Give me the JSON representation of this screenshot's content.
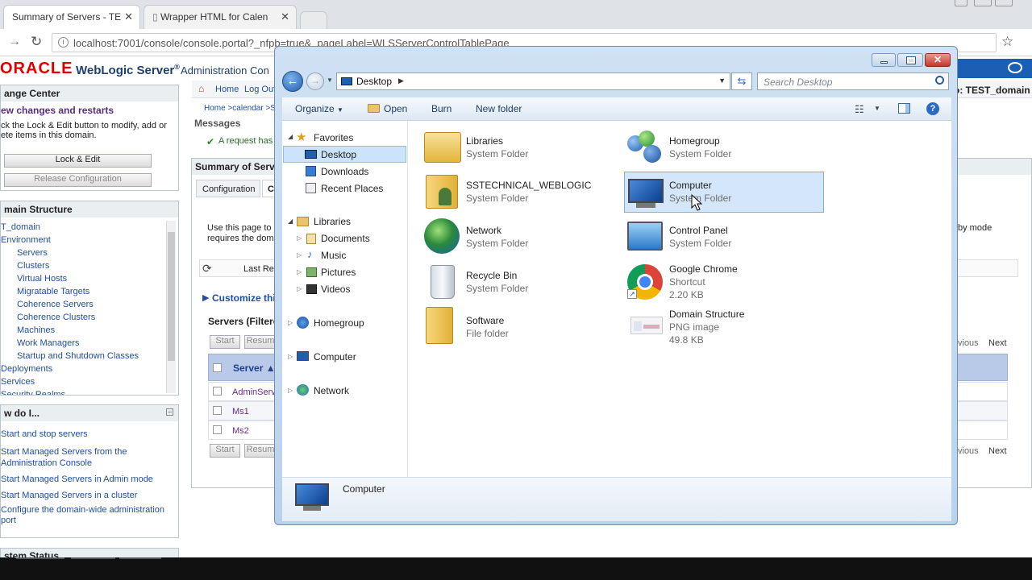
{
  "browser": {
    "tabs": [
      {
        "label": "Summary of Servers - TE"
      },
      {
        "label": "Wrapper HTML for Calen"
      }
    ],
    "address": "localhost:7001/console/console.portal?_nfpb=true&_pageLabel=WLSServerControlTablePage"
  },
  "weblogic": {
    "brand": "ORACLE",
    "product": "WebLogic Server",
    "reg": "®",
    "console": "Administration Con",
    "home": "Home",
    "logout": "Log Out",
    "breadcrumb": "Home >calendar >S",
    "domain_label": "o: TEST_domain",
    "messages": "Messages",
    "request_msg": "A request has",
    "change_center": {
      "title": "ange Center",
      "subtitle": "ew changes and restarts",
      "text1": "ck the Lock & Edit button to modify, add or",
      "text2": "ete items in this domain.",
      "lock_btn": "Lock & Edit",
      "release_btn": "Release Configuration"
    },
    "domain_structure": {
      "title": "main Structure",
      "items": [
        "T_domain",
        "Environment",
        "Servers",
        "Clusters",
        "Virtual Hosts",
        "Migratable Targets",
        "Coherence Servers",
        "Coherence Clusters",
        "Machines",
        "Work Managers",
        "Startup and Shutdown Classes",
        "Deployments",
        "Services",
        "Security Realms"
      ]
    },
    "howdoi": {
      "title": "w do I...",
      "links": [
        "Start and stop servers",
        "Start Managed Servers from the",
        "Administration Console",
        "Start Managed Servers in Admin mode",
        "Start Managed Servers in a cluster",
        "Configure the domain-wide administration",
        "port"
      ]
    },
    "system_status": "stem Status",
    "summary_title": "Summary of Serve",
    "tab_config": "Configuration",
    "tab_c": "C",
    "use_text1": "Use this page to",
    "use_text2": "requires the dom",
    "by_mode": "by mode",
    "last_ref": "Last Ref",
    "customize": "Customize this",
    "servers_filtered": "Servers (Filtere",
    "start": "Start",
    "resume": "Resum",
    "server_col": "Server",
    "rows": [
      "AdminServ",
      "Ms1",
      "Ms2"
    ],
    "previous": "vious",
    "next": "Next"
  },
  "explorer": {
    "location": "Desktop",
    "search_placeholder": "Search Desktop",
    "commands": {
      "organize": "Organize",
      "open": "Open",
      "burn": "Burn",
      "new_folder": "New folder"
    },
    "nav": {
      "favorites": "Favorites",
      "desktop": "Desktop",
      "downloads": "Downloads",
      "recent": "Recent Places",
      "libraries": "Libraries",
      "documents": "Documents",
      "music": "Music",
      "pictures": "Pictures",
      "videos": "Videos",
      "homegroup": "Homegroup",
      "computer": "Computer",
      "network": "Network"
    },
    "items": [
      {
        "name": "Libraries",
        "sub": "System Folder"
      },
      {
        "name": "SSTECHNICAL_WEBLOGIC",
        "sub": "System Folder"
      },
      {
        "name": "Network",
        "sub": "System Folder"
      },
      {
        "name": "Recycle Bin",
        "sub": "System Folder"
      },
      {
        "name": "Software",
        "sub": "File folder"
      },
      {
        "name": "Homegroup",
        "sub": "System Folder"
      },
      {
        "name": "Computer",
        "sub": "System Folder"
      },
      {
        "name": "Control Panel",
        "sub": "System Folder"
      },
      {
        "name": "Google Chrome",
        "sub": "Shortcut",
        "size": "2.20 KB"
      },
      {
        "name": "Domain Structure",
        "sub": "PNG image",
        "size": "49.8 KB"
      }
    ],
    "details_name": "Computer"
  }
}
